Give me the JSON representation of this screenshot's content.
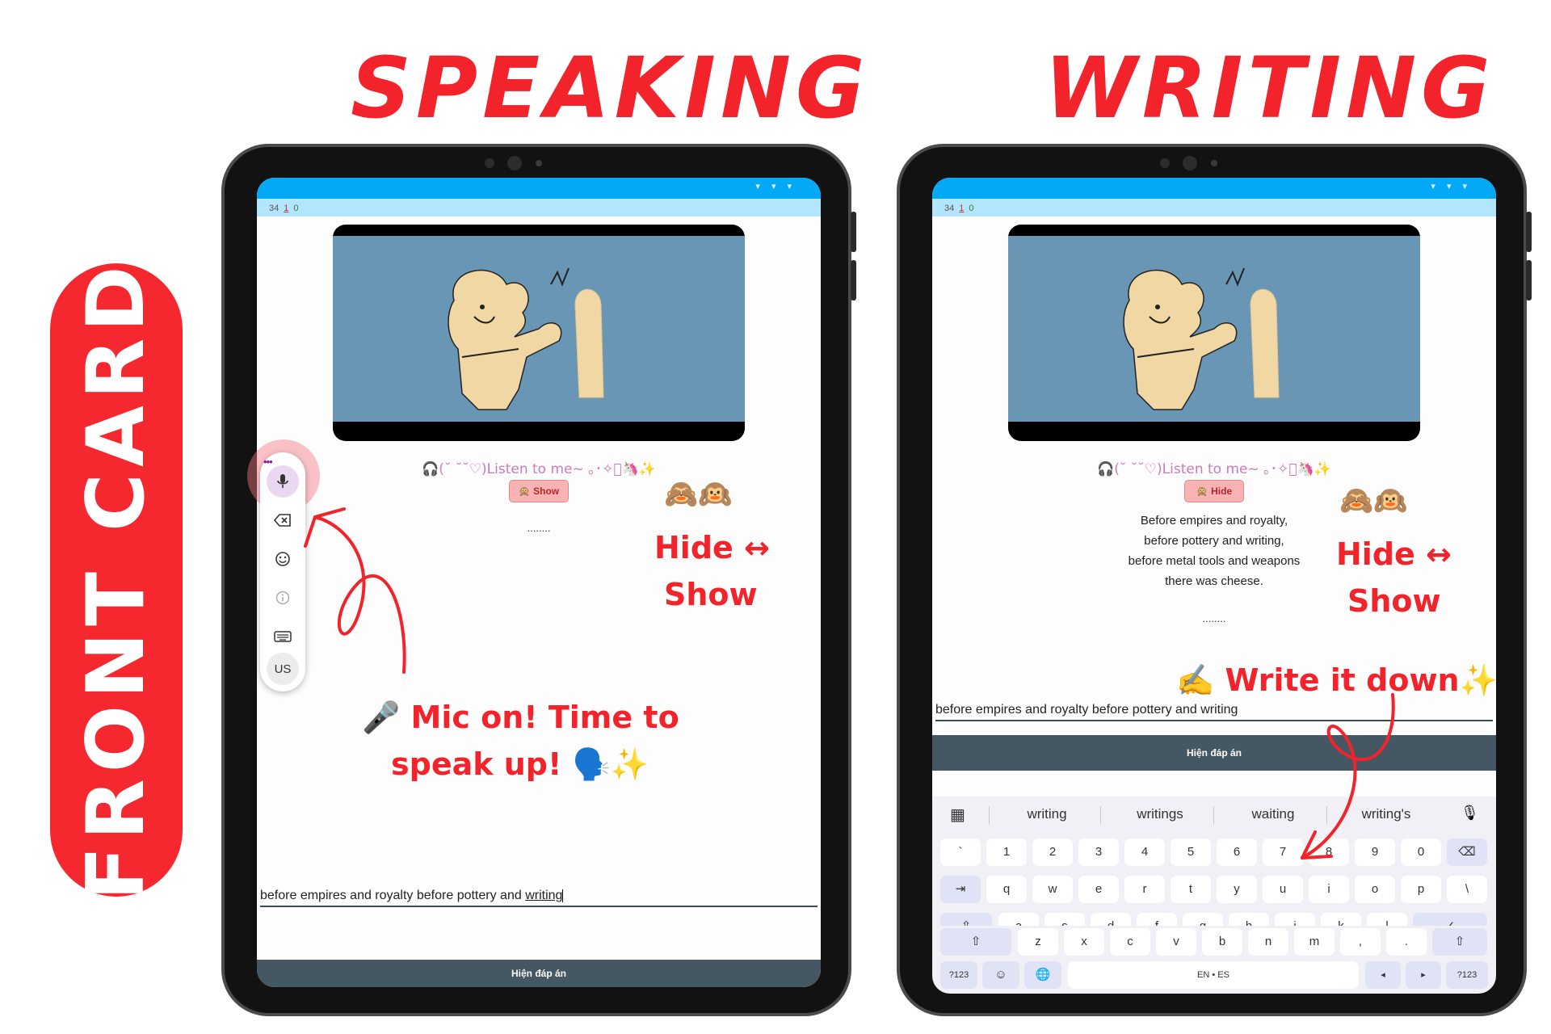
{
  "titles": {
    "speaking": "SPEAKING",
    "writing": "WRITING",
    "front_card": "FRONT CARD"
  },
  "colors": {
    "accent": "#f2232b",
    "status_bar": "#03a9f4",
    "counter_bar": "#b3e5fc",
    "reveal_bar": "#465764"
  },
  "left_tablet": {
    "counter": {
      "total": "34",
      "red": "1",
      "green": "0"
    },
    "listen_line": "🎧(˘ ˘˘♡)Listen to me~ ｡･✧ﾟ🦄✨",
    "toggle_label": "🙊 Show",
    "dots": "........",
    "typed": {
      "prefix": "before empires and royalty before pottery and ",
      "highlight": "writing"
    },
    "reveal_label": "Hiện đáp án",
    "voice_toolbar": {
      "more": "•••",
      "icons": [
        "mic-icon",
        "backspace-icon",
        "emoji-icon",
        "info-icon",
        "keyboard-icon"
      ],
      "lang": "US"
    }
  },
  "right_tablet": {
    "counter": {
      "total": "34",
      "red": "1",
      "green": "0"
    },
    "listen_line": "🎧(˘ ˘˘♡)Listen to me~ ｡･✧ﾟ🦄✨",
    "toggle_label": "🙊 Hide",
    "answer_lines": [
      "Before empires and royalty,",
      "before pottery and writing,",
      "before metal tools and weapons",
      "there was cheese."
    ],
    "dots": "........",
    "typed": "before empires and royalty before pottery and writing",
    "reveal_label": "Hiện đáp án",
    "keyboard": {
      "suggestions": [
        "writing",
        "writings",
        "waiting",
        "writing's"
      ],
      "row1": [
        "`",
        "1",
        "2",
        "3",
        "4",
        "5",
        "6",
        "7",
        "8",
        "9",
        "0"
      ],
      "row2": [
        "q",
        "w",
        "e",
        "r",
        "t",
        "y",
        "u",
        "i",
        "o",
        "p",
        "\\"
      ],
      "row3": [
        "a",
        "s",
        "d",
        "f",
        "g",
        "h",
        "j",
        "k",
        "l"
      ],
      "row4": [
        "z",
        "x",
        "c",
        "v",
        "b",
        "n",
        "m",
        ",",
        "."
      ],
      "key_symbols": "?123",
      "key_symbols_right": "?123",
      "space_label": "EN • ES",
      "key_tab": "⇥",
      "key_caps": "⇪",
      "key_shift": "⇧",
      "key_enter": "✓",
      "key_backspace": "⌫",
      "key_left": "◂",
      "key_right": "▸",
      "key_emoji": "☺",
      "key_globe": "🌐",
      "apps_icon": "▦",
      "mic_icon": "🎙"
    }
  },
  "annotations": {
    "left_hide": "Hide ↔",
    "left_show": "Show",
    "right_hide": "Hide ↔",
    "right_show": "Show",
    "mic_line1": "🎤 Mic on! Time to",
    "mic_line2": "speak up! 🗣️✨",
    "write": "✍️ Write it down✨",
    "monkeys": "🙈🙉"
  }
}
